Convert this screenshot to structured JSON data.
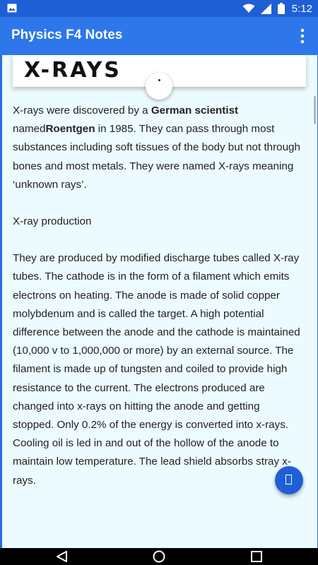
{
  "status_bar": {
    "time": "5:12",
    "icons": [
      "image-notification-icon",
      "wifi-icon",
      "signal-icon",
      "battery-icon"
    ]
  },
  "app_bar": {
    "title": "Physics F4 Notes",
    "overflow_icon": "more-vert-icon"
  },
  "article": {
    "heading": "X-RAYS",
    "p1_a": "X-rays were discovered by a ",
    "p1_b": "German scientist",
    "p1_c": " named",
    "p1_d": "Roentgen",
    "p1_e": " in 1985. They can pass through most substances including soft tissues of the body but not through bones and most metals. They were named X-rays meaning ‘unknown rays’.",
    "subheading": "X-ray production",
    "p2": "They are produced by modified discharge tubes called X-ray tubes. The cathode is in the form of a filament which emits electrons on heating. The anode is made of solid copper molybdenum and is called the target. A high potential difference between the anode and the cathode is maintained (10,000 v to 1,000,000 or more) by an external source. The filament is made up of tungsten and coiled to provide high resistance to the current. The electrons produced are changed into x-rays on hitting the anode and getting stopped. Only 0.2% of the energy is converted into x-rays. Cooling oil is led in and out of the hollow of the anode to maintain low temperature. The lead shield absorbs stray x-rays."
  },
  "nav_bar": {
    "icons": [
      "back-icon",
      "home-icon",
      "recents-icon"
    ]
  },
  "colors": {
    "app_bar": "#2d77ea",
    "status_bar": "#1f5fd6",
    "content_bg": "#ecfbff",
    "fab": "#1f5fd6"
  }
}
